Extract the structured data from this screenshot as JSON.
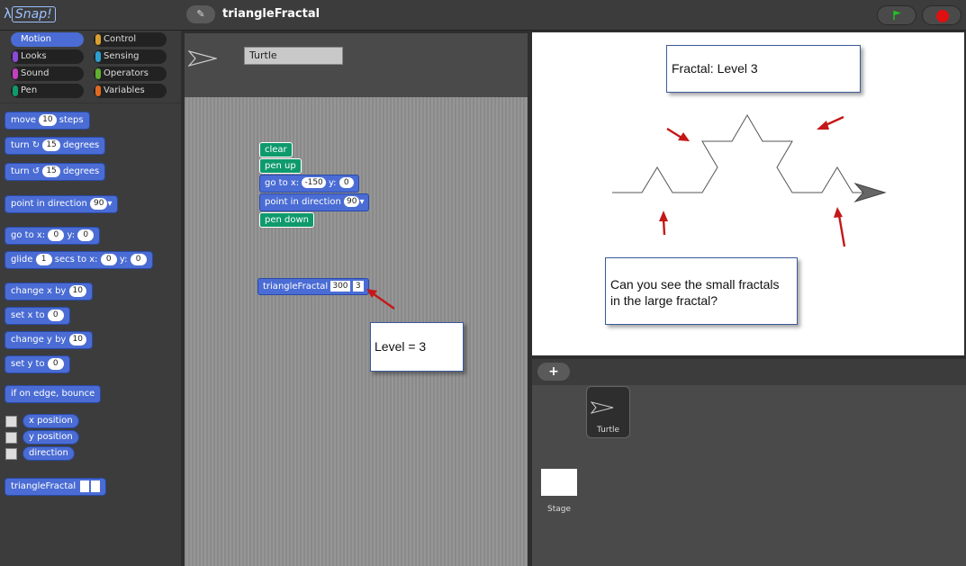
{
  "header": {
    "logo": "Snap!",
    "project_title": "triangleFractal",
    "edit_icon": "pencil-icon",
    "flag_icon": "green-flag-icon",
    "stop_icon": "stop-icon"
  },
  "categories": [
    "Motion",
    "Control",
    "Looks",
    "Sensing",
    "Sound",
    "Operators",
    "Pen",
    "Variables"
  ],
  "palette": {
    "move": {
      "label": "move",
      "steps": "10",
      "suffix": "steps"
    },
    "turn_cw": {
      "label": "turn",
      "value": "15",
      "suffix": "degrees"
    },
    "turn_ccw": {
      "label": "turn",
      "value": "15",
      "suffix": "degrees"
    },
    "point_dir": {
      "label": "point in direction",
      "value": "90"
    },
    "goto": {
      "label": "go to x:",
      "x": "0",
      "ylabel": "y:",
      "y": "0"
    },
    "glide": {
      "label": "glide",
      "secs": "1",
      "mid": "secs to x:",
      "x": "0",
      "ylabel": "y:",
      "y": "0"
    },
    "change_x": {
      "label": "change x by",
      "value": "10"
    },
    "set_x": {
      "label": "set x to",
      "value": "0"
    },
    "change_y": {
      "label": "change y by",
      "value": "10"
    },
    "set_y": {
      "label": "set y to",
      "value": "0"
    },
    "bounce": "if on edge, bounce",
    "x_position": "x position",
    "y_position": "y position",
    "direction": "direction",
    "custom": "triangleFractal"
  },
  "sprite": {
    "name": "Turtle"
  },
  "script": {
    "clear": "clear",
    "pen_up": "pen up",
    "goto": {
      "label": "go to x:",
      "x": "-150",
      "ylabel": "y:",
      "y": "0"
    },
    "point_dir": {
      "label": "point in direction",
      "value": "90"
    },
    "pen_down": "pen down",
    "custom": {
      "label": "triangleFractal",
      "size": "300",
      "level": "3"
    }
  },
  "notes": {
    "level": "Level = 3",
    "fractal": "Fractal: Level 3",
    "question": "Can you see the small fractals in the large fractal?"
  },
  "corral": {
    "add_label": "+",
    "sprite_label": "Turtle",
    "stage_label": "Stage"
  },
  "colors": {
    "motion": "#4a6cd4",
    "pen": "#0e9a6c",
    "arrow": "#c41818",
    "stop": "#e01010",
    "flag": "#22c022"
  }
}
